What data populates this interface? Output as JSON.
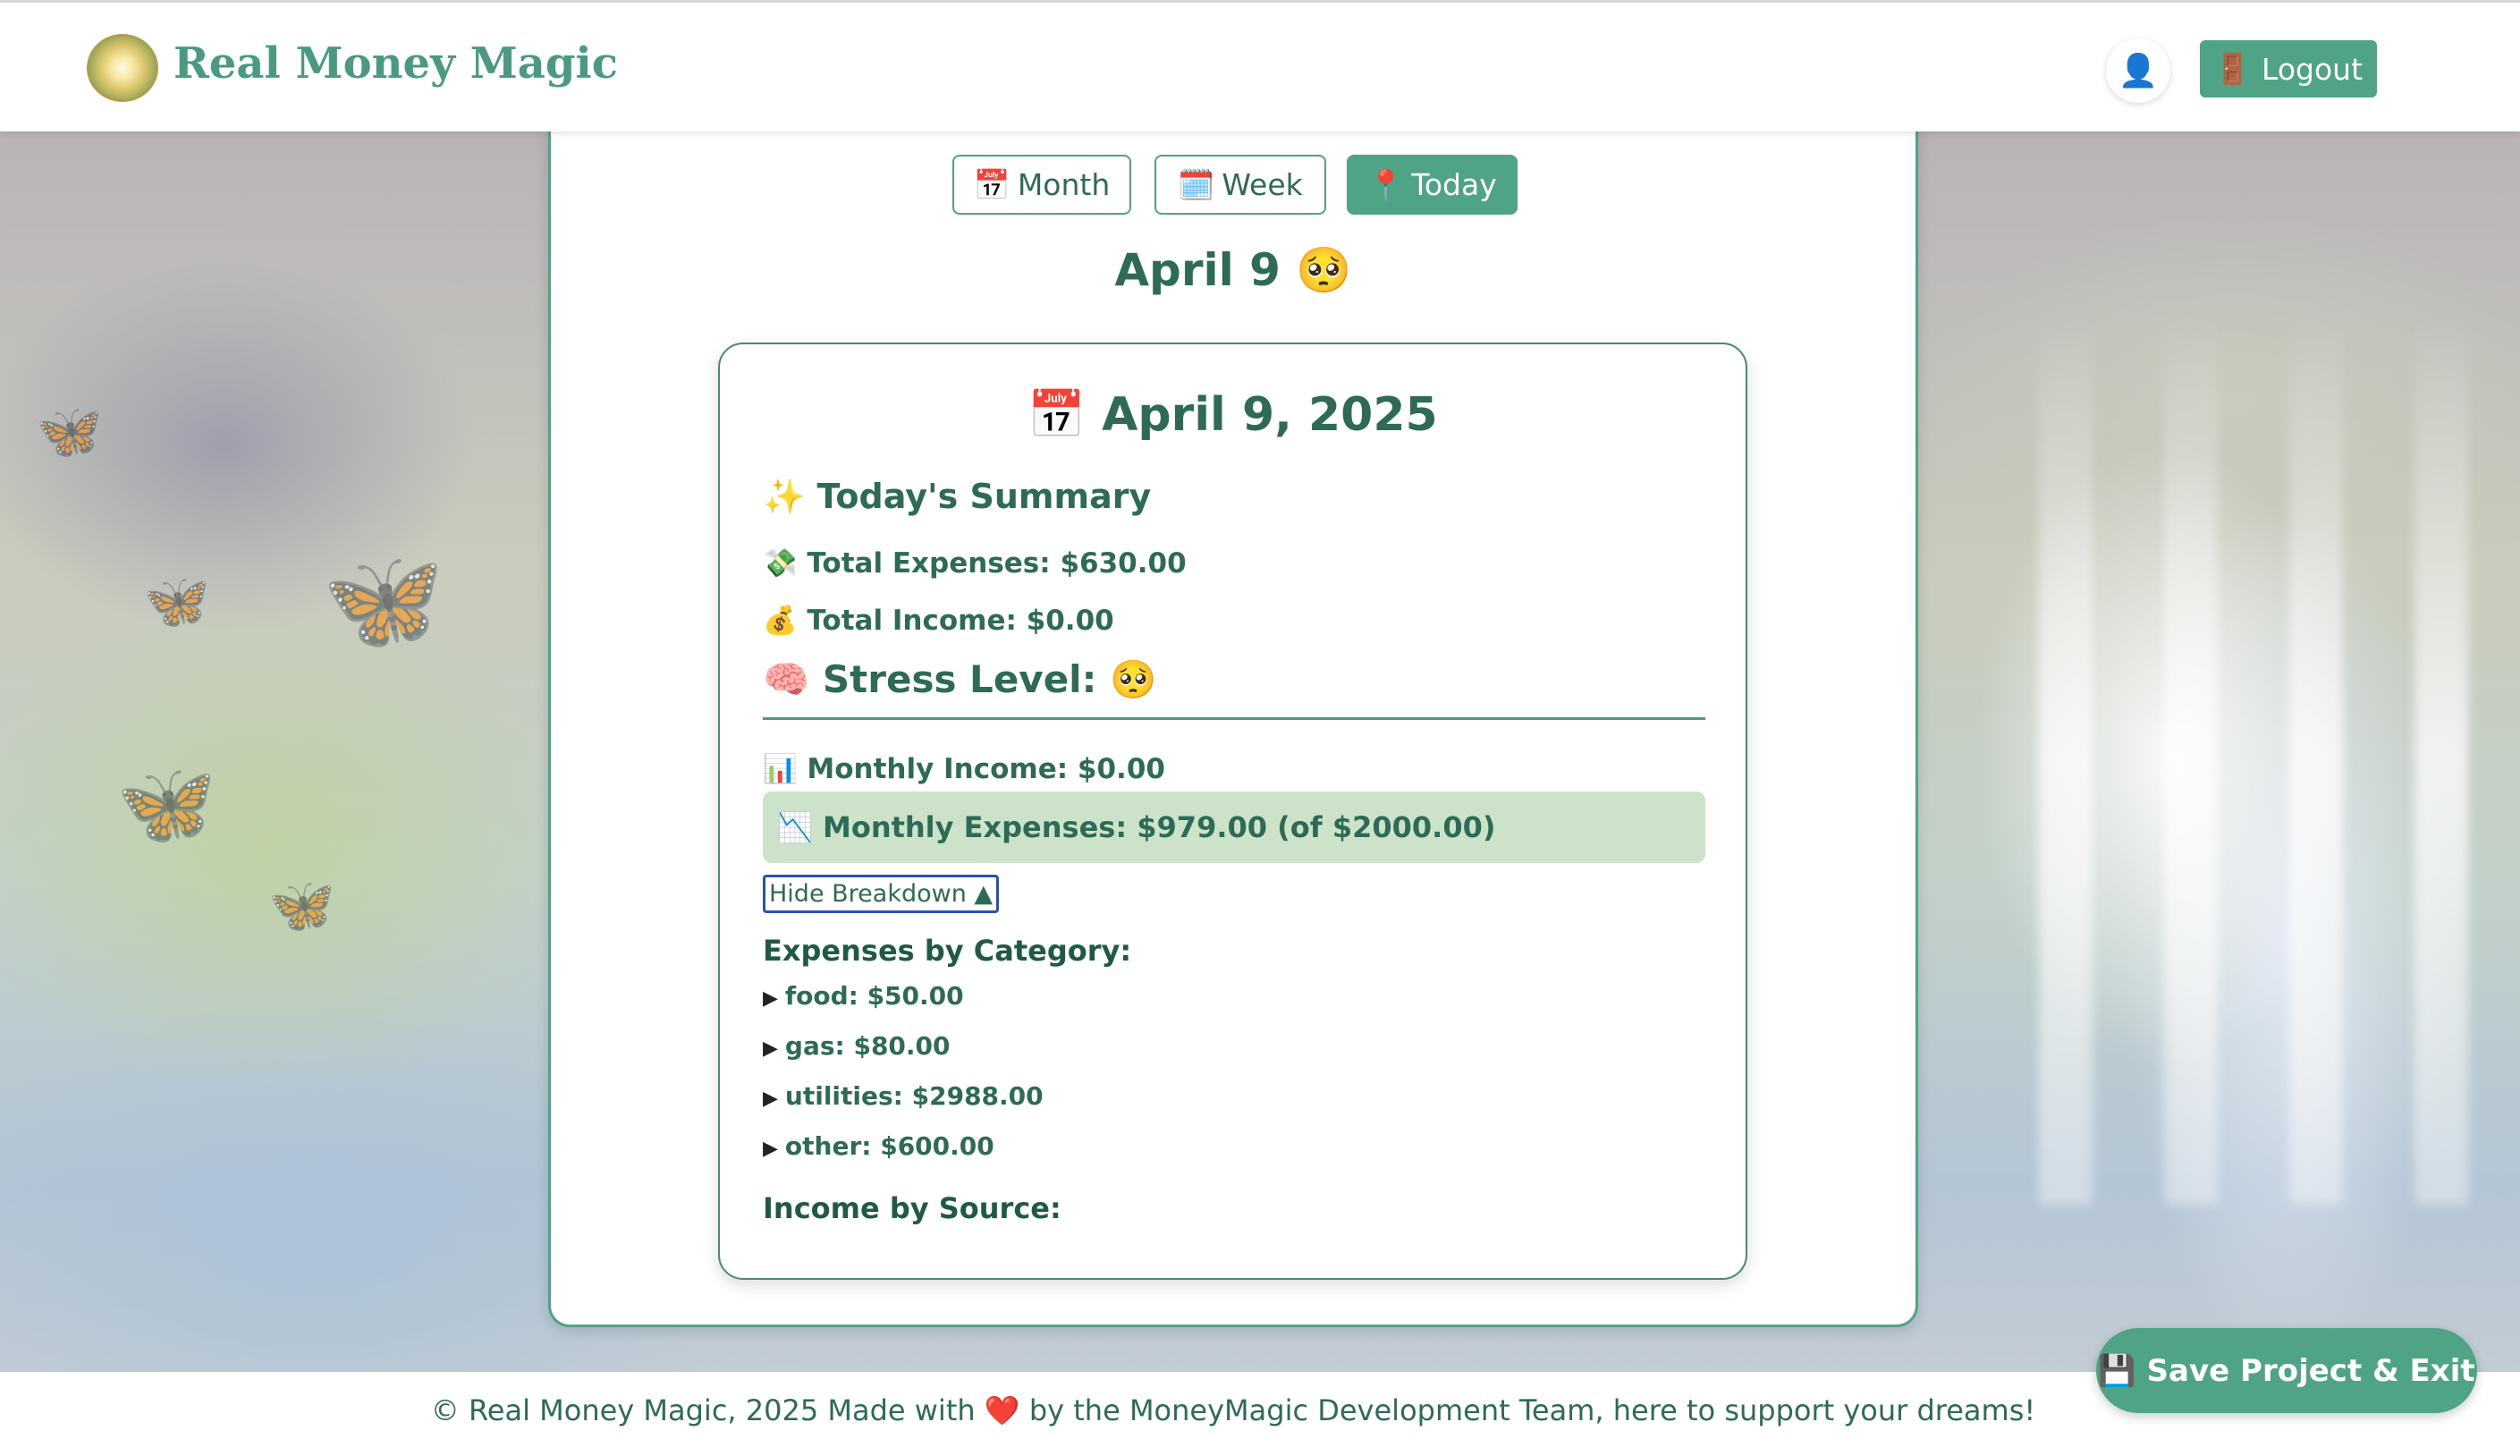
{
  "header": {
    "brand": "Real Money Magic",
    "user_icon": "user-icon",
    "logout_icon": "door-icon",
    "logout_label": "Logout"
  },
  "view_tabs": [
    {
      "icon": "📅",
      "label": "Month",
      "active": false
    },
    {
      "icon": "🗓️",
      "label": "Week",
      "active": false
    },
    {
      "icon": "📍",
      "label": "Today",
      "active": true
    }
  ],
  "day_heading": "April 9 🥺",
  "card": {
    "title": "📅 April 9, 2025",
    "summary_heading": "✨ Today's Summary",
    "total_expenses": "💸 Total Expenses: $630.00",
    "total_income": "💰 Total Income: $0.00",
    "stress_level": "🧠 Stress Level: 🥺",
    "monthly_income": "📊 Monthly Income: $0.00",
    "monthly_expenses": "📉 Monthly Expenses: $979.00 (of $2000.00)",
    "toggle_label": "Hide Breakdown ▲",
    "expenses_by_category_heading": "Expenses by Category:",
    "categories": [
      "food: $50.00",
      "gas: $80.00",
      "utilities: $2988.00",
      "other: $600.00"
    ],
    "income_by_source_heading": "Income by Source:"
  },
  "footer": {
    "text": "© Real Money Magic, 2025 Made with ❤️ by the MoneyMagic Development Team, here to support your dreams!"
  },
  "save_button": {
    "label": "💾 Save Project & Exit"
  },
  "colors": {
    "accent": "#4ea484",
    "text": "#2e6b57",
    "expense_highlight": "#cde3c9",
    "focus_outline": "#2c4fb0"
  }
}
